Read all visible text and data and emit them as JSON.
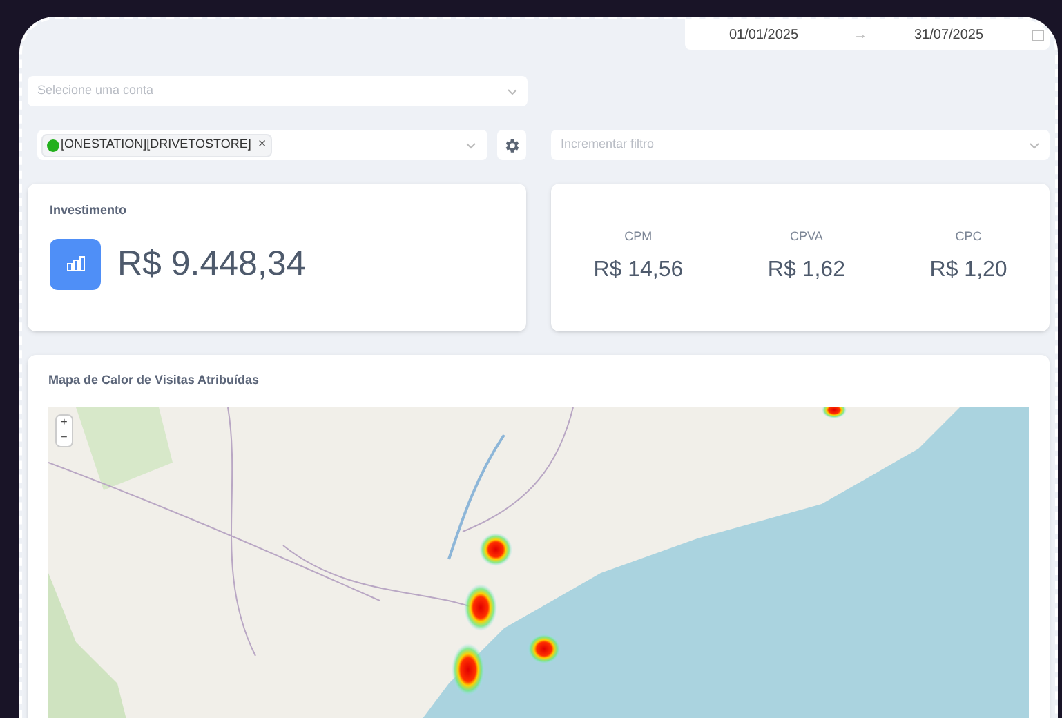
{
  "date_range": {
    "start": "01/01/2025",
    "separator": "→",
    "end": "31/07/2025"
  },
  "account_select": {
    "placeholder": "Selecione uma conta"
  },
  "campaign_select": {
    "tags": [
      {
        "label": "[ONESTATION][DRIVETOSTORE]",
        "remove": "×"
      }
    ]
  },
  "filter_select": {
    "placeholder": "Incrementar filtro"
  },
  "investment_card": {
    "title": "Investimento",
    "value": "R$ 9.448,34"
  },
  "metrics": [
    {
      "label": "CPM",
      "value": "R$ 14,56"
    },
    {
      "label": "CPVA",
      "value": "R$ 1,62"
    },
    {
      "label": "CPC",
      "value": "R$ 1,20"
    }
  ],
  "heatmap": {
    "title": "Mapa de Calor de Visitas Atribuídas",
    "zoom_controls": [
      "+",
      "−"
    ]
  }
}
